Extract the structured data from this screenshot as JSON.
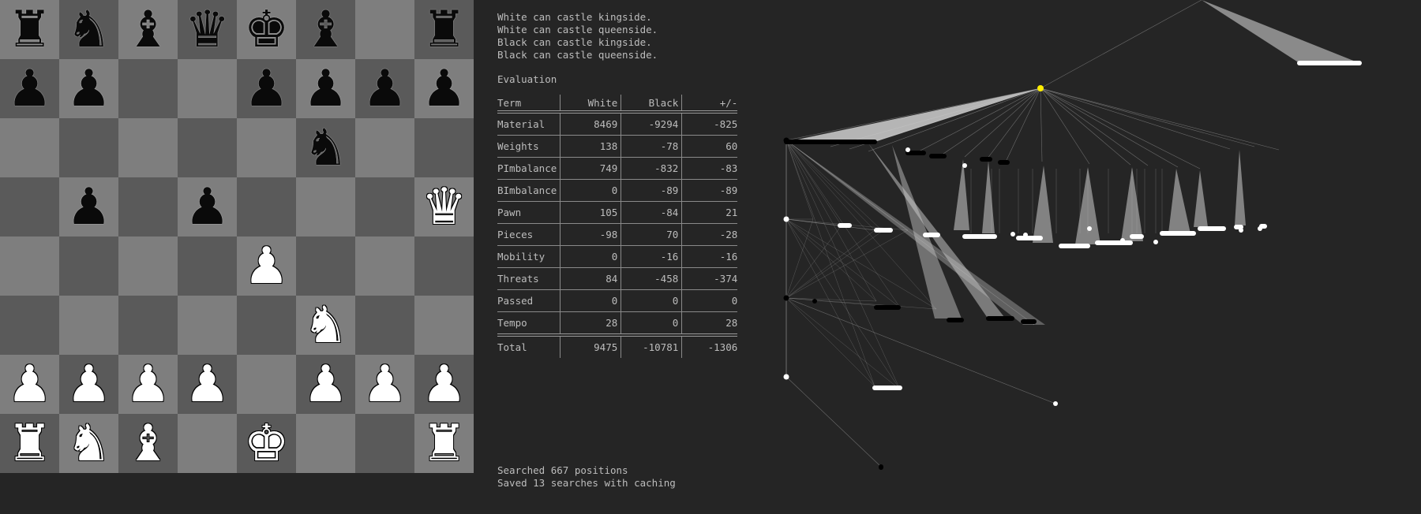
{
  "board": {
    "light_color": "#7e7e7e",
    "dark_color": "#5a5a5a",
    "rows": [
      [
        "bR",
        "bN",
        "bB",
        "bQ",
        "bK",
        "bB",
        "",
        "bR"
      ],
      [
        "bP",
        "bP",
        "",
        "",
        "bP",
        "bP",
        "bP",
        "bP"
      ],
      [
        "",
        "",
        "",
        "",
        "",
        "bN",
        "",
        ""
      ],
      [
        "",
        "bP",
        "",
        "bP",
        "",
        "",
        "",
        "wQ"
      ],
      [
        "",
        "",
        "",
        "",
        "wP",
        "",
        "",
        ""
      ],
      [
        "",
        "",
        "",
        "",
        "",
        "wN",
        "",
        ""
      ],
      [
        "wP",
        "wP",
        "wP",
        "wP",
        "",
        "wP",
        "wP",
        "wP"
      ],
      [
        "wR",
        "wN",
        "wB",
        "",
        "wK",
        "",
        "",
        "wR"
      ]
    ],
    "glyphs": {
      "K": "♚",
      "Q": "♛",
      "R": "♜",
      "B": "♝",
      "N": "♞",
      "P": "♟"
    }
  },
  "castling": [
    "White can castle kingside.",
    "White can castle queenside.",
    "Black can castle kingside.",
    "Black can castle queenside."
  ],
  "evaluation": {
    "title": "Evaluation",
    "headers": [
      "Term",
      "White",
      "Black",
      "+/-"
    ],
    "rows": [
      [
        "Material",
        "8469",
        "-9294",
        "-825"
      ],
      [
        "Weights",
        "138",
        "-78",
        "60"
      ],
      [
        "PImbalance",
        "749",
        "-832",
        "-83"
      ],
      [
        "BImbalance",
        "0",
        "-89",
        "-89"
      ],
      [
        "Pawn",
        "105",
        "-84",
        "21"
      ],
      [
        "Pieces",
        "-98",
        "70",
        "-28"
      ],
      [
        "Mobility",
        "0",
        "-16",
        "-16"
      ],
      [
        "Threats",
        "84",
        "-458",
        "-374"
      ],
      [
        "Passed",
        "0",
        "0",
        "0"
      ],
      [
        "Tempo",
        "28",
        "0",
        "28"
      ]
    ],
    "total": [
      "Total",
      "9475",
      "-10781",
      "-1306"
    ]
  },
  "stats": {
    "searched": "Searched 667 positions",
    "cached": "Saved 13 searches with caching"
  },
  "tree": {
    "root_color": "#ffee00",
    "node_colors": {
      "white": "#ffffff",
      "black": "#000000"
    },
    "edge_color": "#9a9a9a"
  }
}
